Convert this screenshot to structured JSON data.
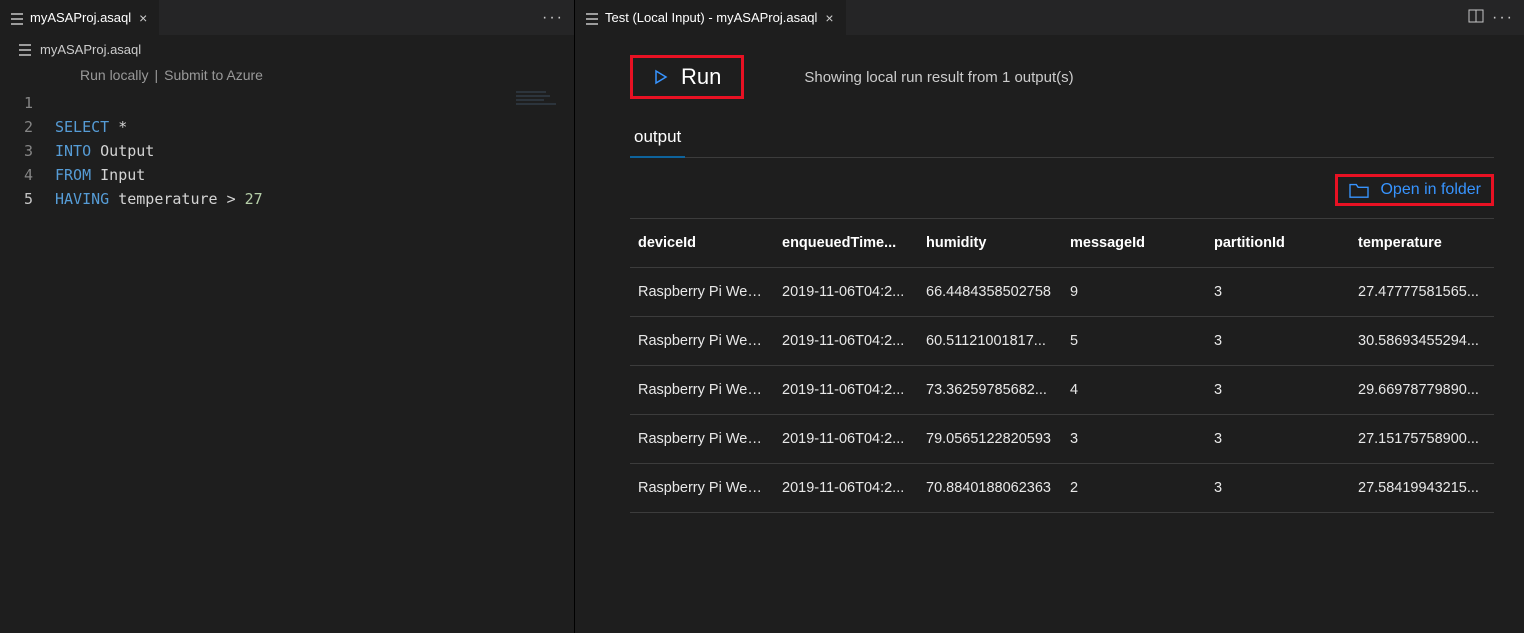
{
  "left": {
    "tab_title": "myASAProj.asaql",
    "header_title": "myASAProj.asaql",
    "actions": {
      "run_locally": "Run locally",
      "sep": "|",
      "submit": "Submit to Azure"
    },
    "code": [
      {
        "n": "1",
        "tokens": []
      },
      {
        "n": "2",
        "tokens": [
          [
            "kw",
            "SELECT"
          ],
          [
            "sp",
            " "
          ],
          [
            "star",
            "*"
          ]
        ]
      },
      {
        "n": "3",
        "tokens": [
          [
            "kw",
            "INTO"
          ],
          [
            "sp",
            " "
          ],
          [
            "id",
            "Output"
          ]
        ]
      },
      {
        "n": "4",
        "tokens": [
          [
            "kw",
            "FROM"
          ],
          [
            "sp",
            " "
          ],
          [
            "id",
            "Input"
          ]
        ]
      },
      {
        "n": "5",
        "tokens": [
          [
            "kw",
            "HAVING"
          ],
          [
            "sp",
            " "
          ],
          [
            "id",
            "temperature"
          ],
          [
            "sp",
            " "
          ],
          [
            "op",
            ">"
          ],
          [
            "sp",
            " "
          ],
          [
            "num",
            "27"
          ]
        ]
      }
    ]
  },
  "right": {
    "tab_title": "Test (Local Input) - myASAProj.asaql",
    "run_label": "Run",
    "status": "Showing local run result from 1 output(s)",
    "output_tab": "output",
    "open_in_folder": "Open in folder",
    "columns": [
      "deviceId",
      "enqueuedTime...",
      "humidity",
      "messageId",
      "partitionId",
      "temperature"
    ],
    "rows": [
      [
        "Raspberry Pi Web ...",
        "2019-11-06T04:2...",
        "66.4484358502758",
        "9",
        "3",
        "27.47777581565..."
      ],
      [
        "Raspberry Pi Web ...",
        "2019-11-06T04:2...",
        "60.51121001817...",
        "5",
        "3",
        "30.58693455294..."
      ],
      [
        "Raspberry Pi Web ...",
        "2019-11-06T04:2...",
        "73.36259785682...",
        "4",
        "3",
        "29.66978779890..."
      ],
      [
        "Raspberry Pi Web ...",
        "2019-11-06T04:2...",
        "79.0565122820593",
        "3",
        "3",
        "27.15175758900..."
      ],
      [
        "Raspberry Pi Web ...",
        "2019-11-06T04:2...",
        "70.8840188062363",
        "2",
        "3",
        "27.58419943215..."
      ]
    ]
  }
}
